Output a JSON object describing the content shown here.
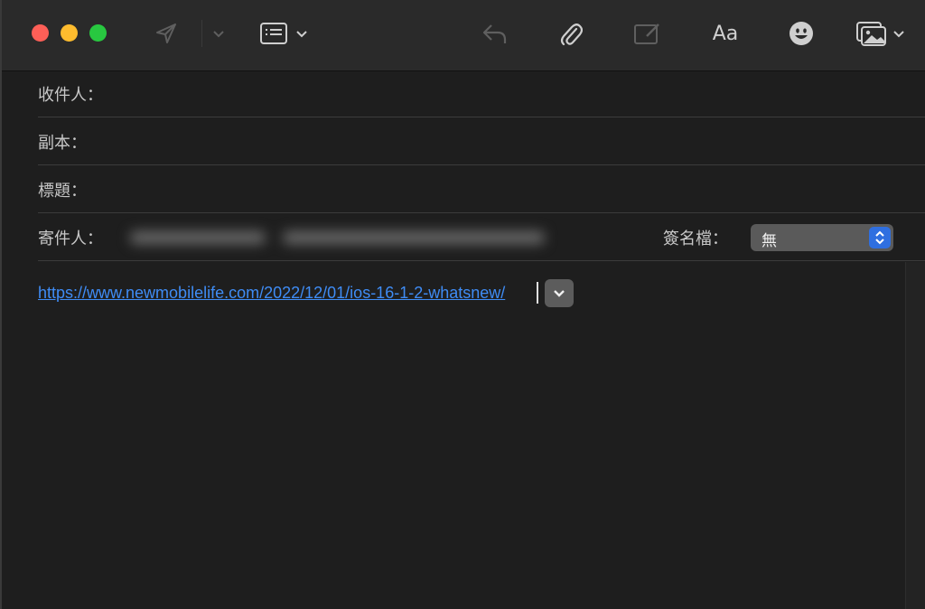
{
  "toolbar": {
    "icons": [
      "send-icon",
      "send-options-chevron-icon",
      "header-fields-icon",
      "header-fields-chevron-icon",
      "reply-icon",
      "attachment-icon",
      "markup-icon",
      "format-icon",
      "emoji-icon",
      "photo-browser-icon",
      "photo-browser-chevron-icon"
    ],
    "format_label": "Aa"
  },
  "fields": {
    "to_label": "收件人：",
    "cc_label": "副本：",
    "subject_label": "標題：",
    "from_label": "寄件人：",
    "signature_label": "簽名檔：",
    "signature_value": "無"
  },
  "body": {
    "link_text": "https://www.newmobilelife.com/2022/12/01/ios-16-1-2-whatsnew/"
  },
  "colors": {
    "background": "#1e1e1e",
    "toolbar": "#2a2a2a",
    "link": "#3f8cf5",
    "accent": "#2f6fe0",
    "close": "#fe5f57",
    "minimize": "#febc2e",
    "zoom": "#28c840"
  }
}
